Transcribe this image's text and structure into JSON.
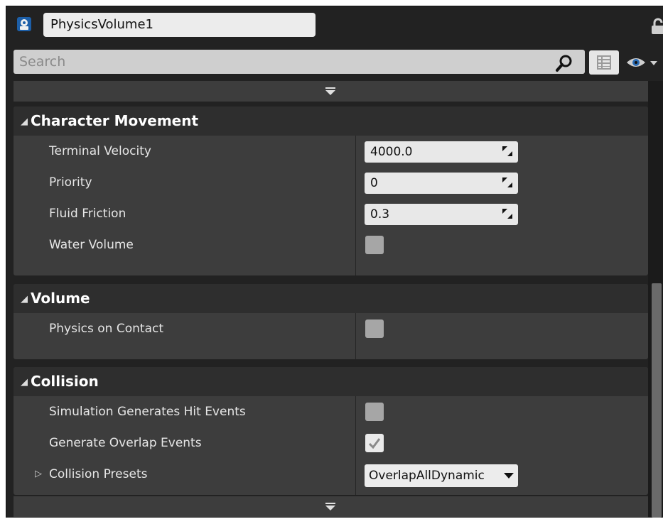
{
  "header": {
    "actor_name": "PhysicsVolume1",
    "actor_icon": "actor-icon",
    "lock_icon": "lock-icon"
  },
  "search": {
    "placeholder": "Search",
    "search_icon": "search-icon",
    "view_options_icon": "grid-icon",
    "visibility_icon": "eye-icon"
  },
  "categories": [
    {
      "title": "Character Movement",
      "rows": [
        {
          "label": "Terminal Velocity",
          "type": "number",
          "value": "4000.0"
        },
        {
          "label": "Priority",
          "type": "number",
          "value": "0"
        },
        {
          "label": "Fluid Friction",
          "type": "number",
          "value": "0.3"
        },
        {
          "label": "Water Volume",
          "type": "checkbox",
          "checked": false
        }
      ]
    },
    {
      "title": "Volume",
      "rows": [
        {
          "label": "Physics on Contact",
          "type": "checkbox",
          "checked": false
        }
      ]
    },
    {
      "title": "Collision",
      "rows": [
        {
          "label": "Simulation Generates Hit Events",
          "type": "checkbox",
          "checked": false
        },
        {
          "label": "Generate Overlap Events",
          "type": "checkbox",
          "checked": true
        },
        {
          "label": "Collision Presets",
          "type": "dropdown",
          "value": "OverlapAllDynamic"
        }
      ]
    }
  ],
  "colors": {
    "panel_bg": "#222222",
    "category_bg": "#3d3d3d",
    "category_header_bg": "#2e2e2e",
    "field_bg": "#e8e8e8"
  }
}
